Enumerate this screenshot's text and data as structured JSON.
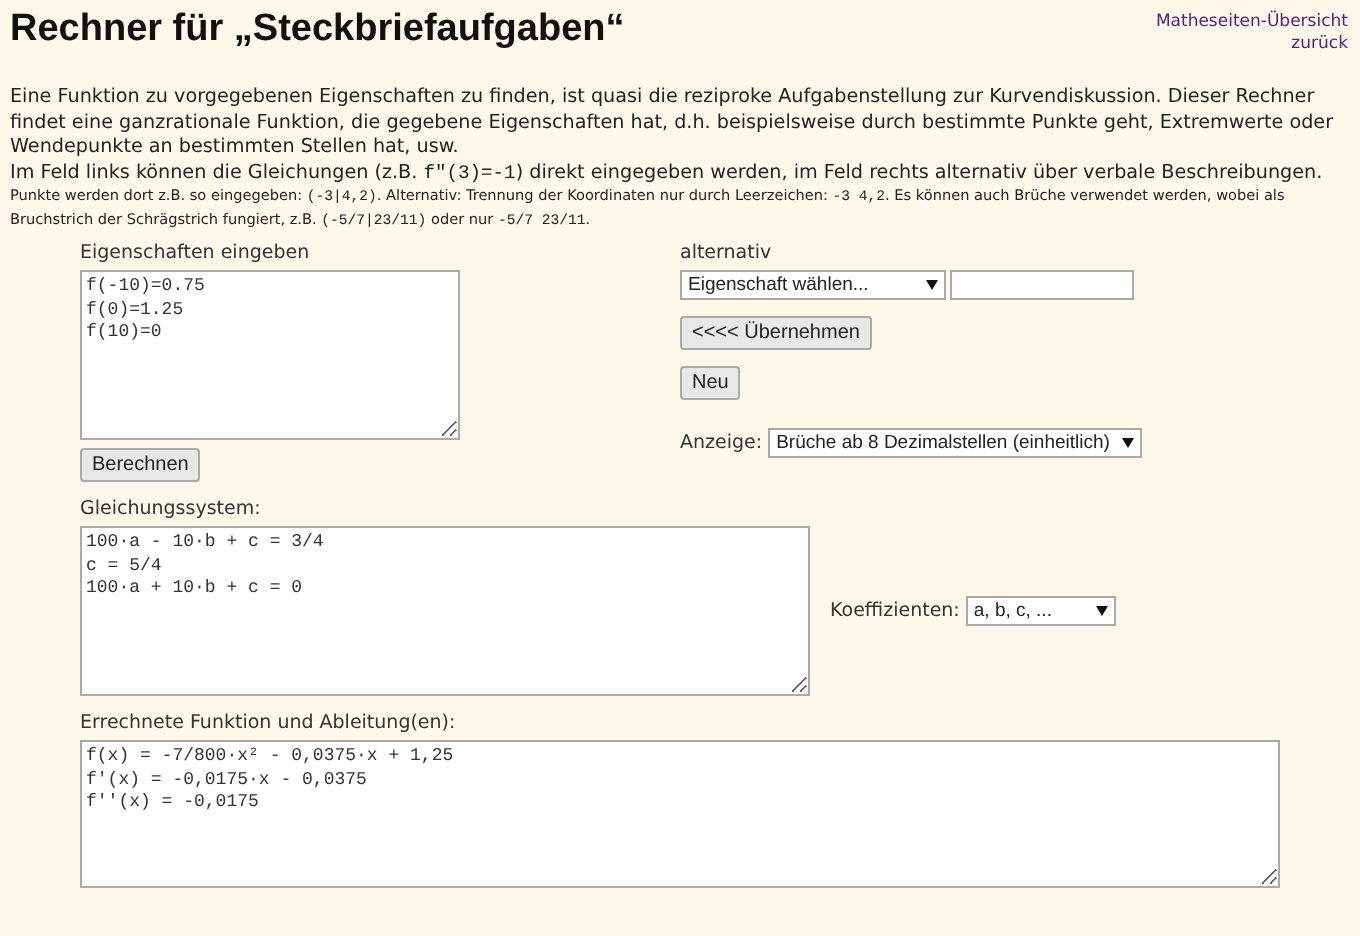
{
  "title": "Rechner für „Steckbriefaufgaben“",
  "nav_links": [
    "Matheseiten-Übersicht",
    "zurück"
  ],
  "intro": [
    [
      {
        "text": "Eine Funktion zu vorgegebenen Eigenschaften zu finden, ist quasi die reziproke Aufgabenstellung zur Kurvendiskussion. Dieser Rechner findet eine ganzrationale Funktion, die gegebene Eigenschaften hat, d.h. beispielsweise durch bestimmte Punkte geht, Extremwerte oder Wendepunkte an bestimmten Stellen hat, usw.",
        "code": false
      }
    ],
    [
      {
        "text": "Im Feld links können die Gleichungen (z.B. ",
        "code": false
      },
      {
        "text": "f\"(3)=-1",
        "code": true
      },
      {
        "text": ") direkt eingegeben werden, im Feld rechts alternativ über verbale Beschreibungen.",
        "code": false
      }
    ]
  ],
  "note": [
    {
      "text": "Punkte werden dort z.B. so eingegeben: ",
      "code": false
    },
    {
      "text": "(-3|4,2)",
      "code": true
    },
    {
      "text": ". Alternativ: Trennung der Koordinaten nur durch Leerzeichen: ",
      "code": false
    },
    {
      "text": "-3 4,2",
      "code": true
    },
    {
      "text": ". Es können auch Brüche verwendet werden, wobei als Bruchstrich der Schrägstrich fungiert, z.B. ",
      "code": false
    },
    {
      "text": "(-5/7|23/11)",
      "code": true
    },
    {
      "text": " oder nur ",
      "code": false
    },
    {
      "text": "-5/7 23/11",
      "code": true
    },
    {
      "text": ".",
      "code": false
    }
  ],
  "properties": {
    "label": "Eigenschaften eingeben",
    "lines": [
      "f(-10)=0.75",
      "f(0)=1.25",
      "f(10)=0"
    ],
    "button": "Berechnen"
  },
  "alternative": {
    "label": "alternativ",
    "select": "Eigenschaft wählen...",
    "apply_button": "<<<< Übernehmen",
    "new_button": "Neu",
    "display_label": "Anzeige:",
    "display_select": "Brüche ab 8 Dezimalstellen (einheitlich)"
  },
  "system": {
    "label": "Gleichungssystem:",
    "lines": [
      "100·a - 10·b + c = 3/4",
      "c = 5/4",
      "100·a + 10·b + c = 0"
    ],
    "coef_label": "Koeffizienten:",
    "coef_select": "a, b, c, ..."
  },
  "result": {
    "label": "Errechnete Funktion und Ableitung(en):",
    "lines": [
      "f(x) = -7/800·x² - 0,0375·x + 1,25",
      "f'(x) = -0,0175·x - 0,0375",
      "f''(x) = -0,0175"
    ]
  }
}
